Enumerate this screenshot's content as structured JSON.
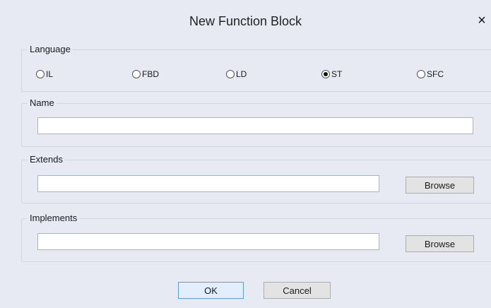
{
  "dialog": {
    "title": "New Function Block",
    "close_glyph": "×"
  },
  "language": {
    "label": "Language",
    "options": [
      {
        "label": "IL",
        "checked": false
      },
      {
        "label": "FBD",
        "checked": false
      },
      {
        "label": "LD",
        "checked": false
      },
      {
        "label": "ST",
        "checked": true
      },
      {
        "label": "SFC",
        "checked": false
      }
    ]
  },
  "name": {
    "label": "Name",
    "value": ""
  },
  "extends": {
    "label": "Extends",
    "value": "",
    "browse_label": "Browse"
  },
  "implements": {
    "label": "Implements",
    "value": "",
    "browse_label": "Browse"
  },
  "footer": {
    "ok_label": "OK",
    "cancel_label": "Cancel"
  },
  "colors": {
    "background": "#e8eaf3",
    "default_button_border": "#5c9cd9"
  }
}
